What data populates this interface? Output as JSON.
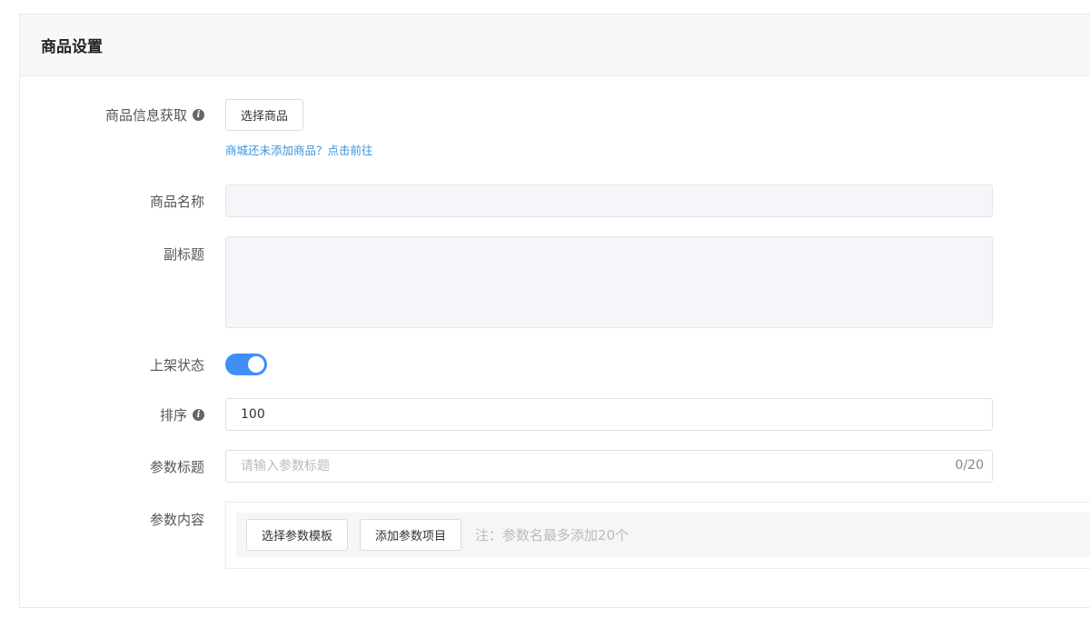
{
  "header": {
    "title": "商品设置"
  },
  "product_info": {
    "label": "商品信息获取",
    "select_button": "选择商品",
    "hint_link": "商城还未添加商品？点击前往"
  },
  "product_name": {
    "label": "商品名称",
    "value": ""
  },
  "subtitle": {
    "label": "副标题",
    "value": ""
  },
  "listing_status": {
    "label": "上架状态",
    "enabled": true
  },
  "sort": {
    "label": "排序",
    "value": "100"
  },
  "param_title": {
    "label": "参数标题",
    "placeholder": "请输入参数标题",
    "counter": "0/20"
  },
  "param_content": {
    "label": "参数内容",
    "template_button": "选择参数模板",
    "add_button": "添加参数项目",
    "note": "注：参数名最多添加20个"
  },
  "colors": {
    "accent": "#3f8ff6",
    "link": "#3b94dc"
  },
  "icons": {
    "info": "info-icon"
  }
}
